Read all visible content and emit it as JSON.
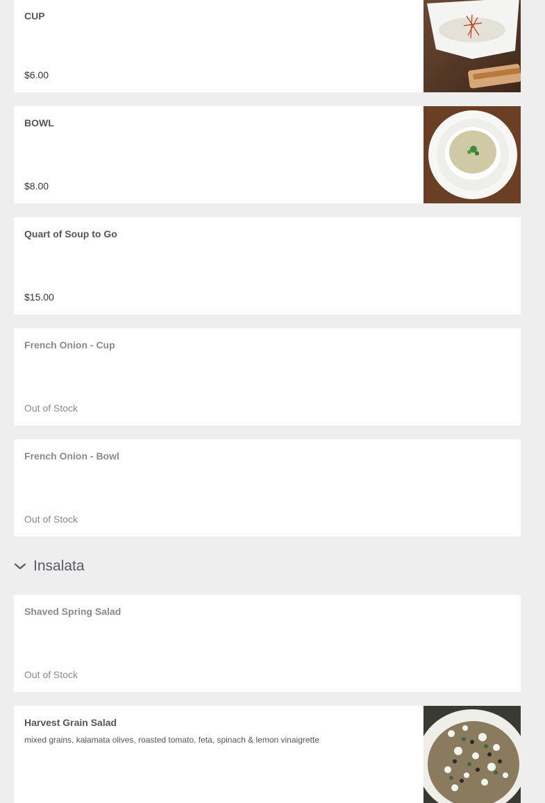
{
  "soup_items": [
    {
      "name": "CUP",
      "price": "$6.00",
      "image": "cup-soup-photo"
    },
    {
      "name": "BOWL",
      "price": "$8.00",
      "image": "bowl-soup-photo"
    },
    {
      "name": "Quart of Soup to Go",
      "price": "$15.00"
    },
    {
      "name": "French Onion - Cup",
      "price": "Out of Stock"
    },
    {
      "name": "French Onion - Bowl",
      "price": "Out of Stock"
    }
  ],
  "section": {
    "title": "Insalata",
    "icon": "chevron-down-icon"
  },
  "salad_items": [
    {
      "name": "Shaved Spring Salad",
      "price": "Out of Stock"
    },
    {
      "name": "Harvest Grain Salad",
      "description": "mixed grains, kalamata olives, roasted tomato, feta, spinach & lemon vinaigrette",
      "image": "grain-salad-photo"
    }
  ],
  "colors": {
    "background": "#eeeeee",
    "card": "#ffffff",
    "out_of_stock": "#8a8a8a"
  }
}
